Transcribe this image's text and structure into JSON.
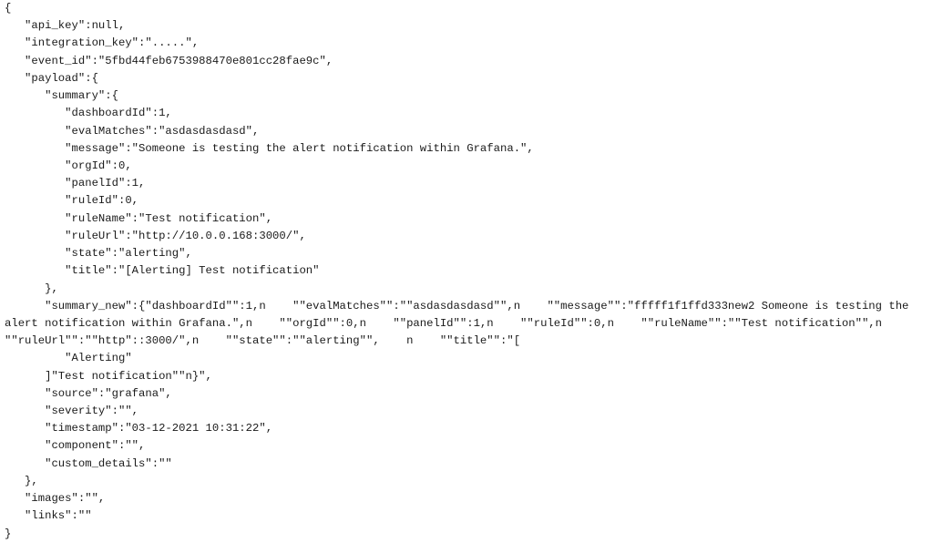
{
  "document": {
    "type": "json-text",
    "lines": [
      "{",
      "   \"api_key\":null,",
      "   \"integration_key\":\".....\",",
      "   \"event_id\":\"5fbd44feb6753988470e801cc28fae9c\",",
      "   \"payload\":{",
      "      \"summary\":{",
      "         \"dashboardId\":1,",
      "         \"evalMatches\":\"asdasdasdasd\",",
      "         \"message\":\"Someone is testing the alert notification within Grafana.\",",
      "         \"orgId\":0,",
      "         \"panelId\":1,",
      "         \"ruleId\":0,",
      "         \"ruleName\":\"Test notification\",",
      "         \"ruleUrl\":\"http://10.0.0.168:3000/\",",
      "         \"state\":\"alerting\",",
      "         \"title\":\"[Alerting] Test notification\"",
      "      },",
      "      \"summary_new\":{\"dashboardId\"\":1,n    \"\"evalMatches\"\":\"\"asdasdasdasd\"\",n    \"\"message\"\":\"fffff1f1ffd333new2 Someone is testing the",
      "alert notification within Grafana.\",n    \"\"orgId\"\":0,n    \"\"panelId\"\":1,n    \"\"ruleId\"\":0,n    \"\"ruleName\"\":\"\"Test notification\"\",n",
      "\"\"ruleUrl\"\":\"\"http\"::3000/\",n    \"\"state\"\":\"\"alerting\"\",    n    \"\"title\"\":\"[",
      "         \"Alerting\"",
      "      ]\"Test notification\"\"n}\",",
      "      \"source\":\"grafana\",",
      "      \"severity\":\"\",",
      "      \"timestamp\":\"03-12-2021 10:31:22\",",
      "      \"component\":\"\",",
      "      \"custom_details\":\"\"",
      "   },",
      "   \"images\":\"\",",
      "   \"links\":\"\"",
      "}"
    ]
  }
}
